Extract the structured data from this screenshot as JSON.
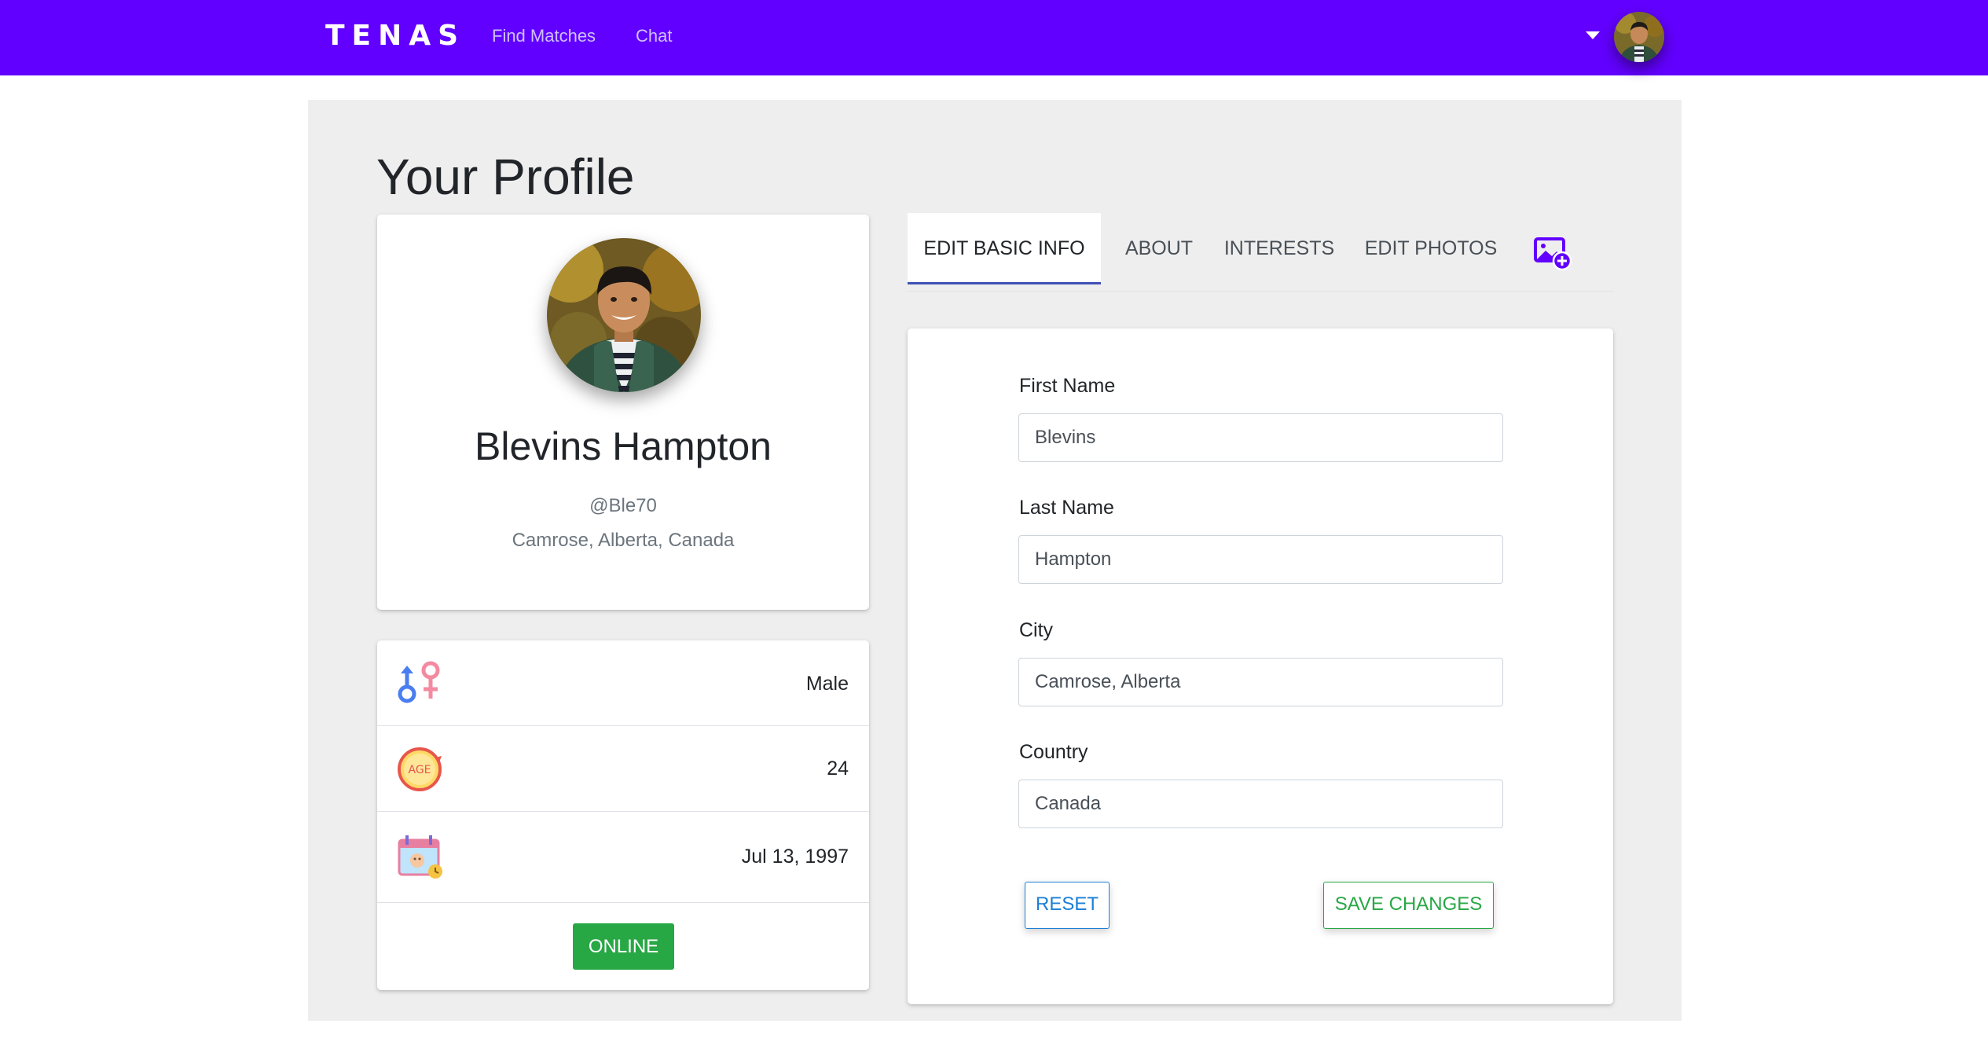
{
  "navbar": {
    "brand": "TENAS",
    "links": [
      "Find Matches",
      "Chat"
    ]
  },
  "page": {
    "title": "Your Profile"
  },
  "profile": {
    "name": "Blevins Hampton",
    "username": "@Ble70",
    "location": "Camrose, Alberta, Canada"
  },
  "info": {
    "gender": "Male",
    "age": "24",
    "birthdate": "Jul 13, 1997",
    "status": "ONLINE"
  },
  "tabs": [
    {
      "label": "EDIT BASIC INFO",
      "active": true
    },
    {
      "label": "ABOUT",
      "active": false
    },
    {
      "label": "INTERESTS",
      "active": false
    },
    {
      "label": "EDIT PHOTOS",
      "active": false
    }
  ],
  "form": {
    "fields": [
      {
        "label": "First Name",
        "value": "Blevins"
      },
      {
        "label": "Last Name",
        "value": "Hampton"
      },
      {
        "label": "City",
        "value": "Camrose, Alberta"
      },
      {
        "label": "Country",
        "value": "Canada"
      }
    ],
    "reset_label": "RESET",
    "save_label": "SAVE CHANGES"
  },
  "colors": {
    "navbar": "#6200ff",
    "accent_tab": "#3f51b5",
    "online": "#28a745",
    "reset": "#1b7fd6",
    "save": "#28a745"
  },
  "icons": {
    "add_photo": "add-photo-icon",
    "gender": "gender-icon",
    "age": "age-icon",
    "birthdate": "calendar-icon",
    "menu": "caret-down-icon"
  }
}
